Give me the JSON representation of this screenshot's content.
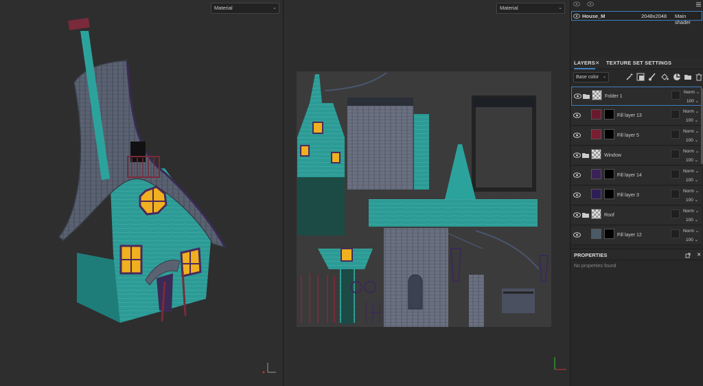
{
  "viewport3d": {
    "dropdown": "Material"
  },
  "viewport2d": {
    "dropdown": "Material"
  },
  "texture_set": {
    "name": "House_M",
    "resolution": "2048x2048",
    "shader": "Main shader"
  },
  "tabs": {
    "layers": "LAYERS",
    "texture_set_settings": "TEXTURE SET SETTINGS"
  },
  "toolbar": {
    "channel": "Base color"
  },
  "layers": [
    {
      "name": "Folder 1",
      "type": "folder",
      "blend": "Norm",
      "opacity": "100"
    },
    {
      "name": "Fill layer 13",
      "type": "fill",
      "blend": "Norm",
      "opacity": "100",
      "color": "#6b1a2e"
    },
    {
      "name": "Fill layer 5",
      "type": "fill",
      "blend": "Norm",
      "opacity": "100",
      "color": "#7a1e34"
    },
    {
      "name": "Window",
      "type": "folder",
      "blend": "Norm",
      "opacity": "100"
    },
    {
      "name": "Fill layer 14",
      "type": "fill",
      "blend": "Norm",
      "opacity": "100",
      "color": "#3a2258"
    },
    {
      "name": "Fill layer 3",
      "type": "fill",
      "blend": "Norm",
      "opacity": "100",
      "color": "#2e1e55"
    },
    {
      "name": "Roof",
      "type": "folder",
      "blend": "Norm",
      "opacity": "100"
    },
    {
      "name": "Fill layer 12",
      "type": "fill",
      "blend": "Norm",
      "opacity": "100",
      "color": "#4a5a66"
    }
  ],
  "properties": {
    "title": "PROPERTIES",
    "empty": "No properties found"
  },
  "colors": {
    "accent": "#3f7fbf",
    "teal": "#2a9a94",
    "roof": "#5a6070",
    "window": "#f0b020"
  }
}
